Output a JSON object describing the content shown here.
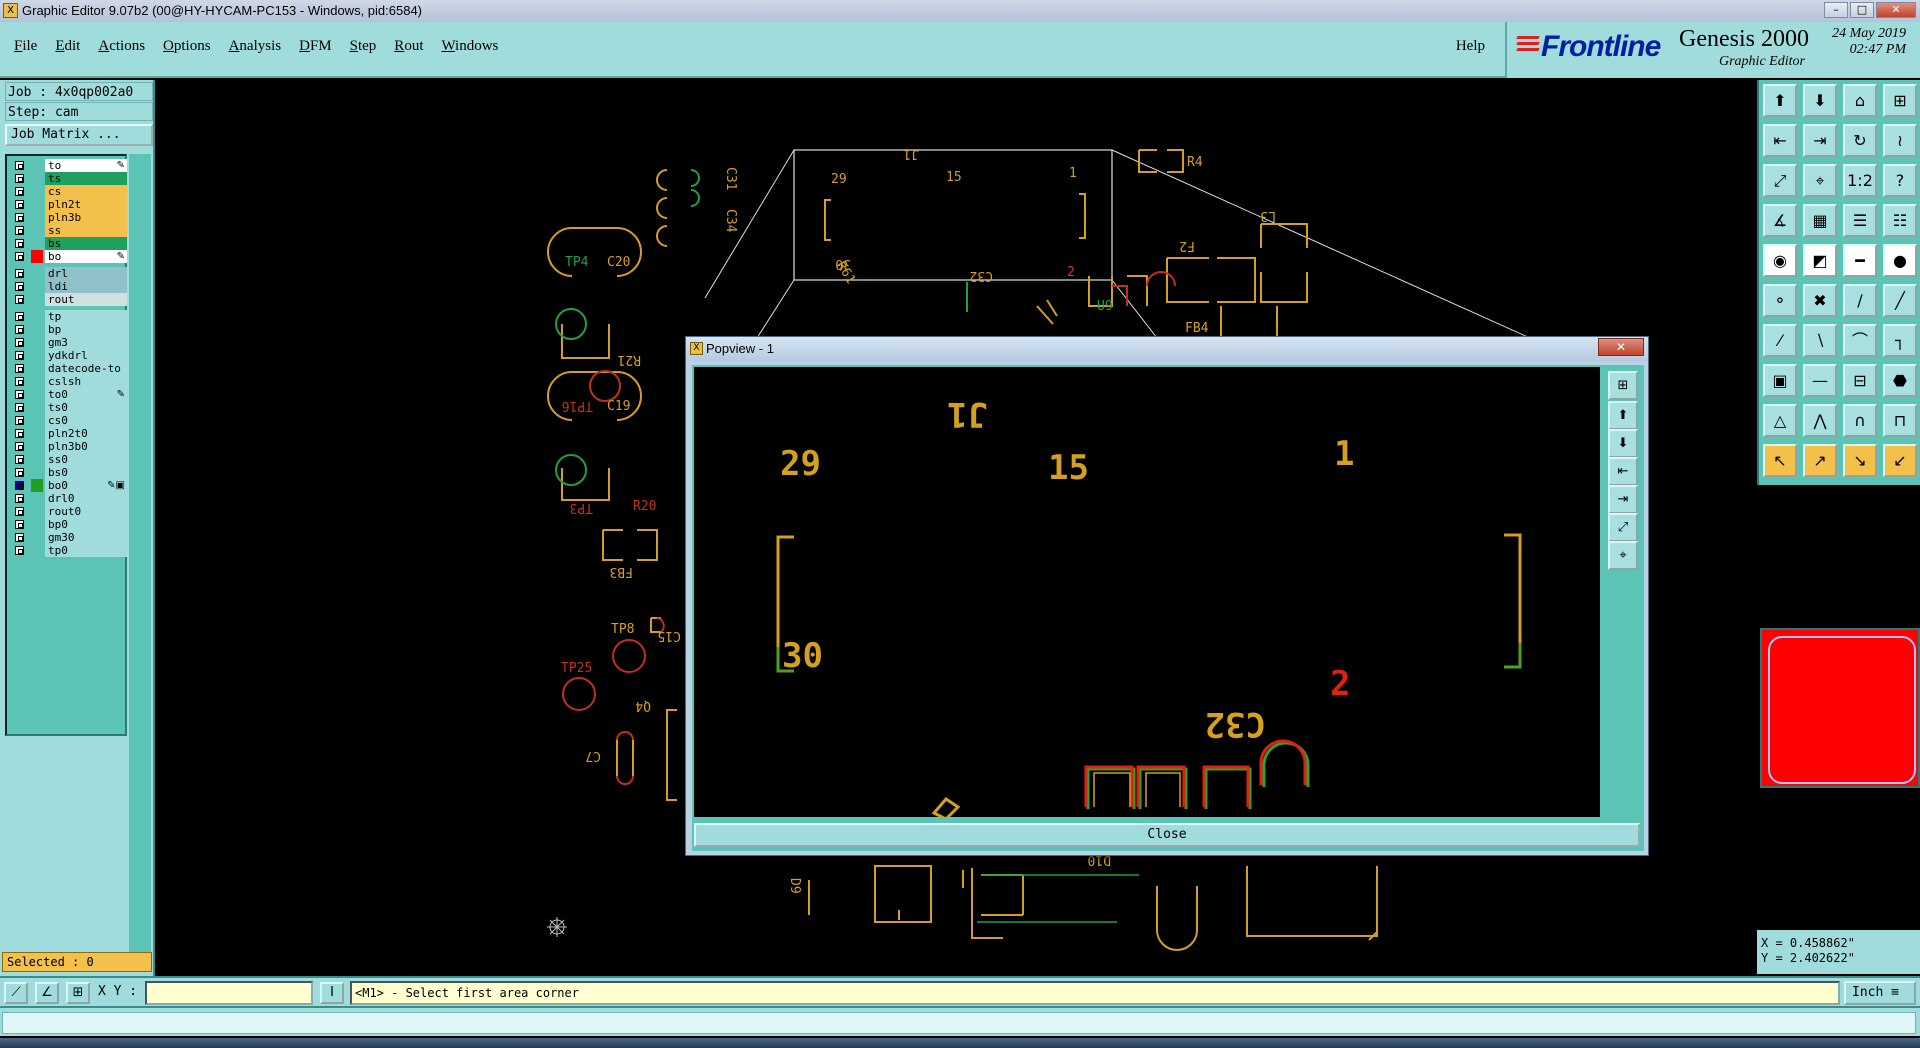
{
  "window": {
    "title": "Graphic Editor 9.07b2 (00@HY-HYCAM-PC153 - Windows, pid:6584)",
    "app_icon": "X"
  },
  "window_controls": {
    "minimize": "–",
    "maximize": "□",
    "close": "✕"
  },
  "menu": {
    "items": [
      "File",
      "Edit",
      "Actions",
      "Options",
      "Analysis",
      "DFM",
      "Step",
      "Rout",
      "Windows"
    ],
    "help": "Help"
  },
  "brand": {
    "logo": "Frontline",
    "product": "Genesis 2000",
    "subtitle": "Graphic Editor",
    "date": "24 May 2019",
    "time": "02:47 PM"
  },
  "job": {
    "job": "Job : 4x0qp002a0",
    "step": "Step: cam",
    "matrix_button": "Job Matrix ..."
  },
  "layers": [
    {
      "name": "to",
      "color": "#ffffff",
      "swatch": "",
      "mark": "✎"
    },
    {
      "name": "ts",
      "color": "#20a060",
      "swatch": "",
      "mark": ""
    },
    {
      "name": "cs",
      "color": "#f4c04c",
      "swatch": "",
      "mark": ""
    },
    {
      "name": "pln2t",
      "color": "#f4c04c",
      "swatch": "",
      "mark": ""
    },
    {
      "name": "pln3b",
      "color": "#f4c04c",
      "swatch": "",
      "mark": ""
    },
    {
      "name": "ss",
      "color": "#f4c04c",
      "swatch": "",
      "mark": ""
    },
    {
      "name": "bs",
      "color": "#20a060",
      "swatch": "",
      "mark": ""
    },
    {
      "name": "bo",
      "color": "#ffffff",
      "swatch": "#ff0000",
      "mark": "✎"
    },
    {
      "name": "drl",
      "color": "#90c0c8",
      "swatch": "",
      "mark": ""
    },
    {
      "name": "ldi",
      "color": "#90c0c8",
      "swatch": "",
      "mark": ""
    },
    {
      "name": "rout",
      "color": "#d0e0e0",
      "swatch": "",
      "mark": ""
    },
    {
      "name": "tp",
      "color": "#a0dcdc",
      "swatch": "",
      "mark": ""
    },
    {
      "name": "bp",
      "color": "#a0dcdc",
      "swatch": "",
      "mark": ""
    },
    {
      "name": "gm3",
      "color": "#a0dcdc",
      "swatch": "",
      "mark": ""
    },
    {
      "name": "ydkdrl",
      "color": "#a0dcdc",
      "swatch": "",
      "mark": ""
    },
    {
      "name": "datecode-to",
      "color": "#a0dcdc",
      "swatch": "",
      "mark": ""
    },
    {
      "name": "cslsh",
      "color": "#a0dcdc",
      "swatch": "",
      "mark": ""
    },
    {
      "name": "to0",
      "color": "#a0dcdc",
      "swatch": "",
      "mark": "✎"
    },
    {
      "name": "ts0",
      "color": "#a0dcdc",
      "swatch": "",
      "mark": ""
    },
    {
      "name": "cs0",
      "color": "#a0dcdc",
      "swatch": "",
      "mark": ""
    },
    {
      "name": "pln2t0",
      "color": "#a0dcdc",
      "swatch": "",
      "mark": ""
    },
    {
      "name": "pln3b0",
      "color": "#a0dcdc",
      "swatch": "",
      "mark": ""
    },
    {
      "name": "ss0",
      "color": "#a0dcdc",
      "swatch": "",
      "mark": ""
    },
    {
      "name": "bs0",
      "color": "#a0dcdc",
      "swatch": "",
      "mark": ""
    },
    {
      "name": "bo0",
      "color": "#a0dcdc",
      "swatch": "#20a020",
      "mark": "✎▣",
      "checked": true
    },
    {
      "name": "drl0",
      "color": "#a0dcdc",
      "swatch": "",
      "mark": ""
    },
    {
      "name": "rout0",
      "color": "#a0dcdc",
      "swatch": "",
      "mark": ""
    },
    {
      "name": "bp0",
      "color": "#a0dcdc",
      "swatch": "",
      "mark": ""
    },
    {
      "name": "gm30",
      "color": "#a0dcdc",
      "swatch": "",
      "mark": ""
    },
    {
      "name": "tp0",
      "color": "#a0dcdc",
      "swatch": "",
      "mark": ""
    }
  ],
  "selected": "Selected : 0",
  "canvas_labels": {
    "ref1": "J1",
    "pin29": "29",
    "pin15": "15",
    "pin1": "1",
    "pin30": "30",
    "pin2": "2",
    "c20": "C20",
    "tp4": "TP4",
    "r21": "R21",
    "c19": "C19",
    "tp16": "TP16",
    "tp3": "TP3",
    "r20": "R20",
    "fb3": "FB3",
    "tp8": "TP8",
    "c15": "C15",
    "tp25": "TP25",
    "q4": "Q4",
    "c7": "C7",
    "r4": "R4",
    "f2": "F2",
    "l3": "L3",
    "fb4": "FB4",
    "u9": "U9",
    "c32": "C32",
    "r61": "R61",
    "c31": "C31",
    "c34": "C34",
    "d10": "D10",
    "d9": "D9"
  },
  "popview": {
    "title": "Popview - 1",
    "close_button": "Close",
    "labels": {
      "ref": "J1",
      "pin29": "29",
      "pin15": "15",
      "pin1": "1",
      "pin30": "30",
      "pin2": "2",
      "c32": "C32"
    }
  },
  "tools": [
    {
      "icon": "layer-up-icon",
      "glyph": "⬆",
      "style": "c"
    },
    {
      "icon": "layer-down-icon",
      "glyph": "⬇",
      "style": "c"
    },
    {
      "icon": "home-icon",
      "glyph": "⌂",
      "style": "c"
    },
    {
      "icon": "grid-icon",
      "glyph": "⊞",
      "style": "c"
    },
    {
      "icon": "pan-left-icon",
      "glyph": "⇤",
      "style": "c"
    },
    {
      "icon": "pan-right-icon",
      "glyph": "⇥",
      "style": "c"
    },
    {
      "icon": "redraw-icon",
      "glyph": "↻",
      "style": "c"
    },
    {
      "icon": "snap-icon",
      "glyph": "≀",
      "style": "c"
    },
    {
      "icon": "zoom-fit-icon",
      "glyph": "⤢",
      "style": "c"
    },
    {
      "icon": "zoom-center-icon",
      "glyph": "⌖",
      "style": "c"
    },
    {
      "icon": "one-to-two-icon",
      "glyph": "1:2",
      "style": "c"
    },
    {
      "icon": "help-icon",
      "glyph": "?",
      "style": "c"
    },
    {
      "icon": "measure-icon",
      "glyph": "∡",
      "style": "c"
    },
    {
      "icon": "table-icon",
      "glyph": "▦",
      "style": "c"
    },
    {
      "icon": "net-icon",
      "glyph": "☰",
      "style": "c"
    },
    {
      "icon": "net-alt-icon",
      "glyph": "☷",
      "style": "c"
    },
    {
      "icon": "pad-icon",
      "glyph": "◉",
      "style": "w"
    },
    {
      "icon": "surface-icon",
      "glyph": "◩",
      "style": "w"
    },
    {
      "icon": "ruler-icon",
      "glyph": "━",
      "style": "w"
    },
    {
      "icon": "dot-icon",
      "glyph": "●",
      "style": "w"
    },
    {
      "icon": "connect-icon",
      "glyph": "⚬",
      "style": "c"
    },
    {
      "icon": "cross-icon",
      "glyph": "✖",
      "style": "c"
    },
    {
      "icon": "line-point-icon",
      "glyph": "∕",
      "style": "c"
    },
    {
      "icon": "line-point-alt-icon",
      "glyph": "╱",
      "style": "c"
    },
    {
      "icon": "draw-line-icon",
      "glyph": "⁄",
      "style": "c"
    },
    {
      "icon": "slash-icon",
      "glyph": "∖",
      "style": "c"
    },
    {
      "icon": "arc-icon",
      "glyph": "⌒",
      "style": "c"
    },
    {
      "icon": "route-icon",
      "glyph": "┐",
      "style": "c"
    },
    {
      "icon": "pad-place-icon",
      "glyph": "▣",
      "style": "c"
    },
    {
      "icon": "segment-icon",
      "glyph": "—",
      "style": "c"
    },
    {
      "icon": "bracket-icon",
      "glyph": "⊟",
      "style": "c"
    },
    {
      "icon": "polygon-icon",
      "glyph": "⬣",
      "style": "c"
    },
    {
      "icon": "triangle-icon",
      "glyph": "△",
      "style": "c"
    },
    {
      "icon": "a-shape-icon",
      "glyph": "⋀",
      "style": "c"
    },
    {
      "icon": "arch-icon",
      "glyph": "∩",
      "style": "c"
    },
    {
      "icon": "arch-alt-icon",
      "glyph": "⊓",
      "style": "c"
    },
    {
      "icon": "select-arrow-icon",
      "glyph": "↖",
      "style": "y"
    },
    {
      "icon": "select-box-icon",
      "glyph": "↗",
      "style": "y"
    },
    {
      "icon": "select-net-icon",
      "glyph": "↘",
      "style": "y"
    },
    {
      "icon": "select-path-icon",
      "glyph": "↙",
      "style": "y"
    }
  ],
  "coords": {
    "x": "X = 0.458862\"",
    "y": "Y = 2.402622\""
  },
  "bottom": {
    "xy_label": "X Y :",
    "xy_value": "",
    "prompt": "<M1> - Select first area corner",
    "units": "Inch ≡"
  }
}
